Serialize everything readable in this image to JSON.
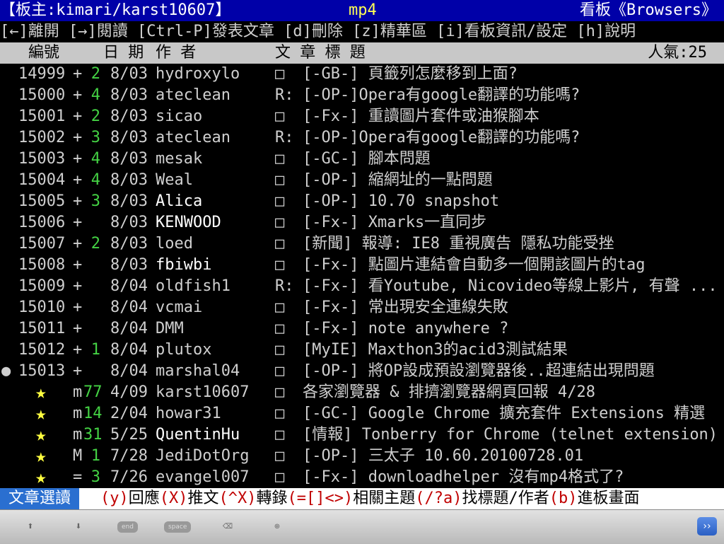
{
  "header": {
    "board_owner": "【板主:kimari/karst10607】",
    "center_label": "mp4",
    "board_name": "看板《Browsers》"
  },
  "help_line": "[←]離開 [→]閱讀 [Ctrl-P]發表文章 [d]刪除 [z]精華區 [i]看板資訊/設定 [h]說明",
  "columns": {
    "num": "編號",
    "date": "日 期",
    "author": "作  者",
    "title": "文  章  標  題",
    "popularity": "人氣:25"
  },
  "rows": [
    {
      "num": "14999",
      "mark": "+",
      "rec": "2",
      "date": "8/03",
      "author": "hydroxylo",
      "box": "□",
      "title": "[-GB-] 頁籤列怎麼移到上面?"
    },
    {
      "num": "15000",
      "mark": "+",
      "rec": "4",
      "date": "8/03",
      "author": "ateclean",
      "box": "R:",
      "title": "[-OP-]Opera有google翻譯的功能嗎?"
    },
    {
      "num": "15001",
      "mark": "+",
      "rec": "2",
      "date": "8/03",
      "author": "sicao",
      "box": "□",
      "title": "[-Fx-] 重讀圖片套件或油猴腳本"
    },
    {
      "num": "15002",
      "mark": "+",
      "rec": "3",
      "date": "8/03",
      "author": "ateclean",
      "box": "R:",
      "title": "[-OP-]Opera有google翻譯的功能嗎?"
    },
    {
      "num": "15003",
      "mark": "+",
      "rec": "4",
      "date": "8/03",
      "author": "mesak",
      "box": "□",
      "title": "[-GC-] 腳本問題"
    },
    {
      "num": "15004",
      "mark": "+",
      "rec": "4",
      "date": "8/03",
      "author": "Weal",
      "box": "□",
      "title": "[-OP-] 縮網址的一點問題"
    },
    {
      "num": "15005",
      "mark": "+",
      "rec": "3",
      "date": "8/03",
      "author": "Alica",
      "box": "□",
      "title": "[-OP-] 10.70 snapshot",
      "bright": true
    },
    {
      "num": "15006",
      "mark": "+",
      "rec": "",
      "date": "8/03",
      "author": "KENWOOD",
      "box": "□",
      "title": "[-Fx-] Xmarks一直同步",
      "bright": true
    },
    {
      "num": "15007",
      "mark": "+",
      "rec": "2",
      "date": "8/03",
      "author": "loed",
      "box": "□",
      "title": "[新聞] 報導: IE8 重視廣告 隱私功能受挫"
    },
    {
      "num": "15008",
      "mark": "+",
      "rec": "",
      "date": "8/03",
      "author": "fbiwbi",
      "box": "□",
      "title": "[-Fx-] 點圖片連結會自動多一個開該圖片的tag",
      "bright": true
    },
    {
      "num": "15009",
      "mark": "+",
      "rec": "",
      "date": "8/04",
      "author": "oldfish1",
      "box": "R:",
      "title": "[-Fx-] 看Youtube, Nicovideo等線上影片, 有聲 ..."
    },
    {
      "num": "15010",
      "mark": "+",
      "rec": "",
      "date": "8/04",
      "author": "vcmai",
      "box": "□",
      "title": "[-Fx-] 常出現安全連線失敗"
    },
    {
      "num": "15011",
      "mark": "+",
      "rec": "",
      "date": "8/04",
      "author": "DMM",
      "box": "□",
      "title": "[-Fx-] note anywhere ?"
    },
    {
      "num": "15012",
      "mark": "+",
      "rec": "1",
      "date": "8/04",
      "author": "plutox",
      "box": "□",
      "title": "[MyIE] Maxthon3的acid3測試結果"
    },
    {
      "num": "15013",
      "mark": "+",
      "rec": "",
      "date": "8/04",
      "author": "marshal04",
      "box": "□",
      "title": "[-OP-] 將OP設成預設瀏覽器後..超連結出現問題",
      "cursor": true
    },
    {
      "num": "★",
      "mark": "m",
      "rec": "77",
      "date": "4/09",
      "author": "karst10607",
      "box": "□",
      "title": "各家瀏覽器 & 排擠瀏覽器網頁回報 4/28"
    },
    {
      "num": "★",
      "mark": "m",
      "rec": "14",
      "date": "2/04",
      "author": "howar31",
      "box": "□",
      "title": "[-GC-] Google Chrome 擴充套件 Extensions 精選"
    },
    {
      "num": "★",
      "mark": "m",
      "rec": "31",
      "date": "5/25",
      "author": "QuentinHu",
      "box": "□",
      "title": "[情報] Tonberry for Chrome (telnet extension)",
      "bright": true
    },
    {
      "num": "★",
      "mark": "M",
      "rec": "1",
      "date": "7/28",
      "author": "JediDotOrg",
      "box": "□",
      "title": "[-OP-] 三太子 10.60.20100728.01"
    },
    {
      "num": "★",
      "mark": "=",
      "rec": "3",
      "date": "7/26",
      "author": "evangel007",
      "box": "□",
      "title": "[-Fx-] downloadhelper 沒有mp4格式了?"
    }
  ],
  "cursor_glyph": "●",
  "footer": {
    "tag": "文章選讀",
    "keys": [
      {
        "k": "(y)",
        "t": "回應"
      },
      {
        "k": "(X)",
        "t": "推文"
      },
      {
        "k": "(^X)",
        "t": "轉錄"
      },
      {
        "k": "(=[]<>)",
        "t": "相關主題"
      },
      {
        "k": "(/?a)",
        "t": "找標題/作者"
      },
      {
        "k": "(b)",
        "t": "進板畫面"
      }
    ]
  },
  "toolbar": {
    "up_icon": "⬆",
    "down_icon": "⬇",
    "end_label": "end",
    "space_label": "space",
    "backspace_icon": "⌫",
    "zoom_icon": "⊕",
    "more_icon": "››"
  }
}
